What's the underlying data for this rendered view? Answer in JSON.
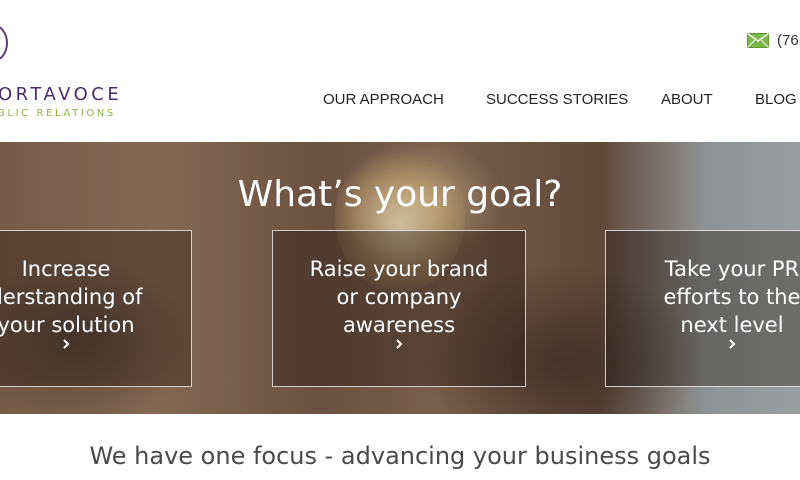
{
  "logo": {
    "name": "ORTAVOCE",
    "tagline": "BLIC RELATIONS"
  },
  "contact": {
    "phone": "(76",
    "icon": "envelope-icon"
  },
  "nav": {
    "items": [
      {
        "label": "OUR APPROACH"
      },
      {
        "label": "SUCCESS STORIES"
      },
      {
        "label": "ABOUT"
      },
      {
        "label": "BLOG"
      }
    ]
  },
  "hero": {
    "title": "What’s your goal?",
    "cards": [
      {
        "text": "Increase\nderstanding of\nyour solution",
        "icon": "chevron-right-icon"
      },
      {
        "text": "Raise your brand\nor company\nawareness",
        "icon": "chevron-right-icon"
      },
      {
        "text": "Take your PR\nefforts to the\nnext level",
        "icon": "chevron-right-icon"
      }
    ]
  },
  "focus": {
    "text": "We have one focus - advancing your business goals"
  },
  "colors": {
    "brand_purple": "#4a2e6b",
    "brand_green": "#8db540",
    "mail_green": "#7ab648"
  }
}
